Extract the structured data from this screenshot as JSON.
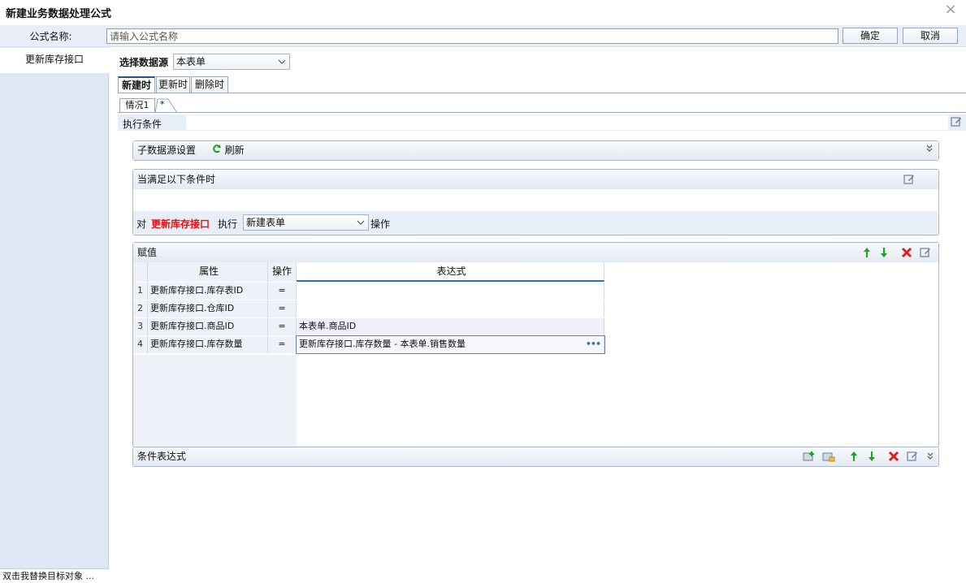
{
  "window": {
    "title": "新建业务数据处理公式",
    "close_glyph": "×"
  },
  "name_row": {
    "label": "公式名称:",
    "input_placeholder": "请输入公式名称",
    "ok_label": "确定",
    "cancel_label": "取消"
  },
  "sidebar": {
    "items": [
      {
        "label": "更新库存接口"
      }
    ],
    "footer": "双击我替换目标对象   ..."
  },
  "datasource": {
    "label": "选择数据源",
    "selected": "本表单"
  },
  "tabs": [
    {
      "label": "新建时",
      "active": true
    },
    {
      "label": "更新时",
      "active": false
    },
    {
      "label": "删除时",
      "active": false
    }
  ],
  "case_tabs": {
    "current": "情况1",
    "add": "*"
  },
  "exec_condition": {
    "label": "执行条件",
    "value": ""
  },
  "sub_datasource": {
    "label": "子数据源设置",
    "refresh_label": "刷新"
  },
  "condition_panel": {
    "title": "当满足以下条件时",
    "prefix": "对",
    "target": "更新库存接口",
    "exec_label": "执行",
    "operation": "新建表单",
    "suffix": "操作"
  },
  "assign_panel": {
    "title": "赋值",
    "columns": [
      "属性",
      "操作",
      "表达式"
    ],
    "rows": [
      {
        "num": "1",
        "attr": "更新库存接口.库存表ID",
        "op": "=",
        "expr": ""
      },
      {
        "num": "2",
        "attr": "更新库存接口.仓库ID",
        "op": "=",
        "expr": ""
      },
      {
        "num": "3",
        "attr": "更新库存接口.商品ID",
        "op": "=",
        "expr": "本表单.商品ID"
      },
      {
        "num": "4",
        "attr": "更新库存接口.库存数量",
        "op": "=",
        "expr": "更新库存接口.库存数量 - 本表单.销售数量"
      }
    ],
    "more_glyph": "•••"
  },
  "cond_expr_panel": {
    "title": "条件表达式"
  },
  "colors": {
    "accent": "#2d4f8a",
    "green_arrow": "#18a518",
    "red_delete": "#e01e1e",
    "target_red": "#e01010"
  }
}
